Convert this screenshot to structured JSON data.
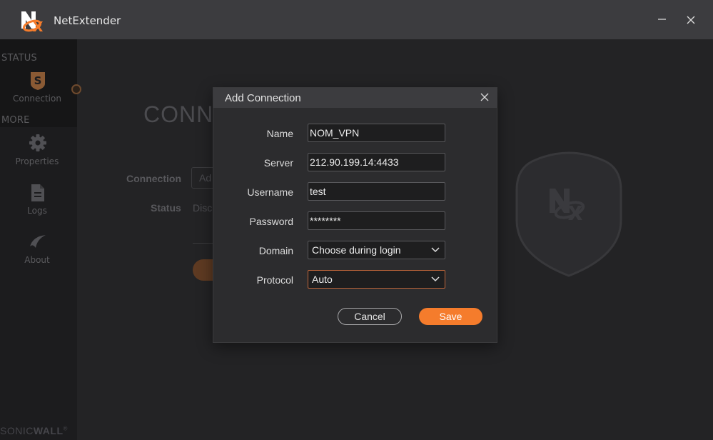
{
  "app": {
    "title": "NetExtender",
    "logo_icon": "netextender-logo-icon"
  },
  "window_controls": {
    "minimize_icon": "minimize-icon",
    "close_icon": "close-icon"
  },
  "sidebar": {
    "status_label": "STATUS",
    "more_label": "MORE",
    "items": [
      {
        "label": "Connection",
        "icon": "shield-s-icon"
      },
      {
        "label": "Properties",
        "icon": "gear-icon"
      },
      {
        "label": "Logs",
        "icon": "document-icon"
      },
      {
        "label": "About",
        "icon": "sonicwall-swoosh-icon"
      }
    ],
    "brand_light": "SONIC",
    "brand_bold": "WALL",
    "brand_mark": "®"
  },
  "main": {
    "title_partial": "CONN",
    "connection_label": "Connection",
    "connection_value_partial": "Ad",
    "status_label": "Status",
    "status_value_partial": "Disc"
  },
  "dialog": {
    "title": "Add Connection",
    "close_icon": "close-icon",
    "fields": {
      "name_label": "Name",
      "name_value": "NOM_VPN",
      "server_label": "Server",
      "server_value": "212.90.199.14:4433",
      "username_label": "Username",
      "username_value": "test",
      "password_label": "Password",
      "password_value": "********",
      "domain_label": "Domain",
      "domain_value": "Choose during login",
      "protocol_label": "Protocol",
      "protocol_value": "Auto"
    },
    "cancel_label": "Cancel",
    "save_label": "Save"
  },
  "colors": {
    "accent": "#f57c2c",
    "titlebar": "#3c3c3f",
    "background": "#232325",
    "sidebar": "#1c1c1e"
  }
}
